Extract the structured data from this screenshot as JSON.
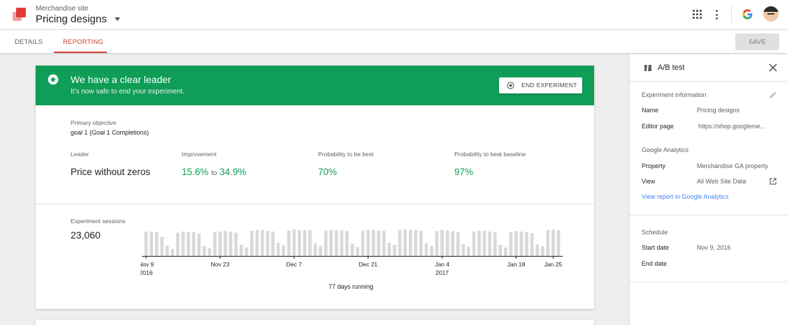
{
  "colors": {
    "accent": "#d23f31",
    "banner": "#0f9d58",
    "link": "#4285f4",
    "bar": "#d9d9d9"
  },
  "header": {
    "site": "Merchandise site",
    "container": "Pricing designs"
  },
  "tabs": [
    {
      "label": "DETAILS"
    },
    {
      "label": "REPORTING"
    }
  ],
  "toolbar": {
    "save_label": "SAVE"
  },
  "banner": {
    "title": "We have a clear leader",
    "subtitle": "It's now safe to end your experiment.",
    "button": "END EXPERIMENT",
    "icon": "star-circle-icon"
  },
  "objective": {
    "label": "Primary objective",
    "value": "goal 1 (Goal 1 Completions)"
  },
  "metrics": {
    "leader_label": "Leader",
    "leader_value": "Price without zeros",
    "improvement_label": "Improvement",
    "improvement_low": "15.6%",
    "improvement_to": "to",
    "improvement_high": "34.9%",
    "prob_best_label": "Probability to be best",
    "prob_best_value": "70%",
    "prob_baseline_label": "Probability to beat baseline",
    "prob_baseline_value": "97%"
  },
  "sessions": {
    "label": "Experiment sessions",
    "value": "23,060",
    "running": "77 days running"
  },
  "chart_data": {
    "type": "bar",
    "start": "Nov 9 2016",
    "ticks": [
      {
        "label": "Nov 9",
        "sub": "2016",
        "day": 0
      },
      {
        "label": "Nov 23",
        "sub": "",
        "day": 14
      },
      {
        "label": "Dec 7",
        "sub": "",
        "day": 28
      },
      {
        "label": "Dec 21",
        "sub": "",
        "day": 42
      },
      {
        "label": "Jan 4",
        "sub": "2017",
        "day": 56
      },
      {
        "label": "Jan 18",
        "sub": "",
        "day": 70
      },
      {
        "label": "Jan 25",
        "sub": "",
        "day": 77
      }
    ],
    "values": [
      0.92,
      0.91,
      0.9,
      0.72,
      0.38,
      0.26,
      0.88,
      0.92,
      0.9,
      0.9,
      0.85,
      0.38,
      0.3,
      0.9,
      0.92,
      0.94,
      0.92,
      0.88,
      0.42,
      0.32,
      0.95,
      0.98,
      0.97,
      0.95,
      0.92,
      0.5,
      0.4,
      0.96,
      1.0,
      0.98,
      0.98,
      0.96,
      0.48,
      0.38,
      0.96,
      0.98,
      0.97,
      0.96,
      0.94,
      0.46,
      0.34,
      0.96,
      0.99,
      0.98,
      0.96,
      0.94,
      0.5,
      0.42,
      0.98,
      1.0,
      0.99,
      0.98,
      0.94,
      0.48,
      0.38,
      0.94,
      0.98,
      0.96,
      0.94,
      0.9,
      0.45,
      0.35,
      0.92,
      0.96,
      0.95,
      0.92,
      0.9,
      0.42,
      0.32,
      0.9,
      0.94,
      0.92,
      0.9,
      0.86,
      0.44,
      0.36,
      0.98,
      1.0,
      0.98
    ],
    "ylim": [
      0,
      1
    ]
  },
  "panel": {
    "title": "A/B test",
    "info_section": "Experiment information",
    "name_key": "Name",
    "name_val": "Pricing designs",
    "editor_key": "Editor page",
    "editor_val": "https://shop.googleme...",
    "ga_section": "Google Analytics",
    "property_key": "Property",
    "property_val": "Merchandise GA property",
    "view_key": "View",
    "view_val": "All Web Site Data",
    "report_link": "View report in Google Analytics",
    "schedule_section": "Schedule",
    "start_key": "Start date",
    "start_val": "Nov 9, 2016",
    "end_key": "End date"
  }
}
